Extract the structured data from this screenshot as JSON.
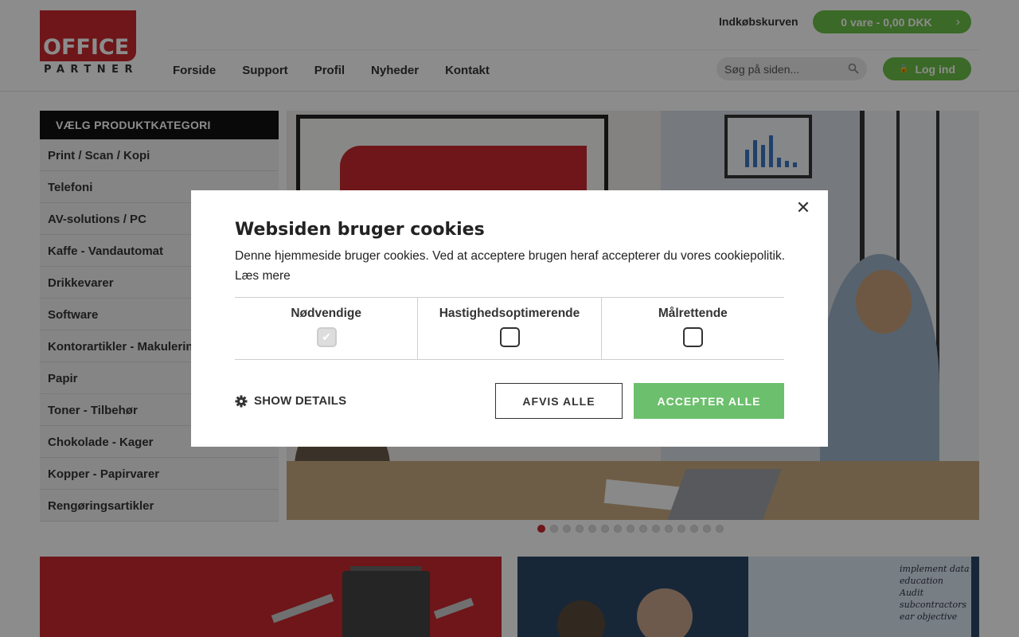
{
  "brand": {
    "logo_word_top": "OFFICE",
    "logo_word_bottom": "PARTNER",
    "accent_red": "#c8282e",
    "accent_green": "#6cbf47"
  },
  "header": {
    "cart_label": "Indkøbskurven",
    "cart_summary": "0 vare - 0,00 DKK",
    "nav": [
      "Forside",
      "Support",
      "Profil",
      "Nyheder",
      "Kontakt"
    ],
    "search_placeholder": "Søg på siden...",
    "login_label": "Log ind"
  },
  "sidebar": {
    "heading": "VÆLG PRODUKTKATEGORI",
    "items": [
      "Print / Scan / Kopi",
      "Telefoni",
      "AV-solutions / PC",
      "Kaffe - Vandautomat",
      "Drikkevarer",
      "Software",
      "Kontorartikler - Makulering",
      "Papir",
      "Toner - Tilbehør",
      "Chokolade - Kager",
      "Kopper - Papirvarer",
      "Rengøringsartikler"
    ]
  },
  "slider": {
    "dot_count": 15,
    "active_index": 0
  },
  "tiles": {
    "tile2_notes": [
      "implement data",
      "education",
      "Audit subcontractors",
      "ear objective"
    ]
  },
  "cookie_dialog": {
    "title": "Websiden bruger cookies",
    "text": "Denne hjemmeside bruger cookies. Ved at acceptere brugen heraf accepterer du vores cookiepolitik.",
    "read_more": "Læs mere",
    "categories": [
      {
        "label": "Nødvendige",
        "checked": true,
        "disabled": true
      },
      {
        "label": "Hastighedsoptimerende",
        "checked": false,
        "disabled": false
      },
      {
        "label": "Målrettende",
        "checked": false,
        "disabled": false
      }
    ],
    "show_details": "SHOW DETAILS",
    "reject_label": "AFVIS ALLE",
    "accept_label": "ACCEPTER ALLE"
  }
}
